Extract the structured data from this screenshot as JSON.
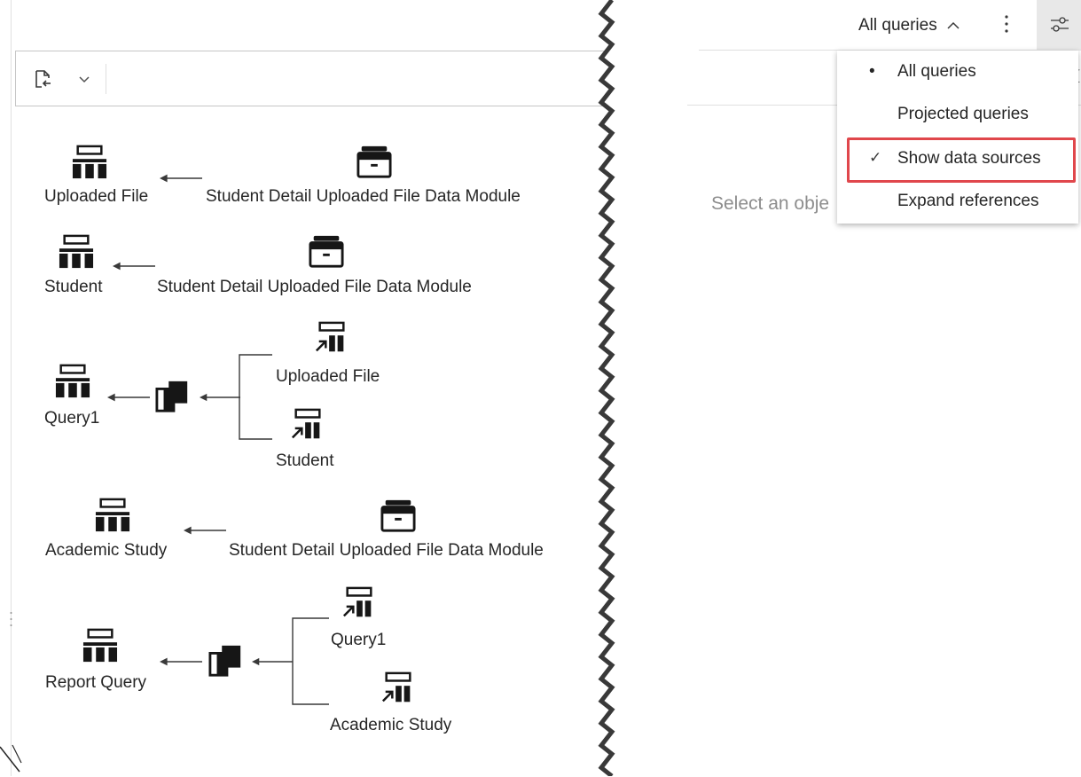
{
  "toolbar": {
    "export_icon": "document-export-icon",
    "dropdown_icon": "chevron-down-icon"
  },
  "diagram": {
    "groups": [
      {
        "target": "Uploaded File",
        "source": "Student Detail Uploaded File Data Module"
      },
      {
        "target": "Student",
        "source": "Student Detail Uploaded File Data Module"
      },
      {
        "target": "Query1",
        "operation": "join-icon",
        "inputs": [
          "Uploaded File",
          "Student"
        ]
      },
      {
        "target": "Academic Study",
        "source": "Student Detail Uploaded File Data Module"
      },
      {
        "target": "Report Query",
        "operation": "join-icon",
        "inputs": [
          "Query1",
          "Academic Study"
        ]
      }
    ]
  },
  "header": {
    "query_selector_label": "All queries",
    "query_selector_icon": "chevron-up-icon",
    "more_icon": "overflow-menu-vertical-icon",
    "filter_icon": "settings-adjust-icon"
  },
  "menu": {
    "items": [
      {
        "label": "All queries",
        "mark": "•"
      },
      {
        "label": "Projected queries",
        "mark": ""
      },
      {
        "label": "Show data sources",
        "mark": "✓"
      },
      {
        "label": "Expand references",
        "mark": ""
      }
    ]
  },
  "properties": {
    "placeholder": "Select an obje"
  },
  "colors": {
    "highlight": "#e0474c",
    "icon": "#161616"
  }
}
